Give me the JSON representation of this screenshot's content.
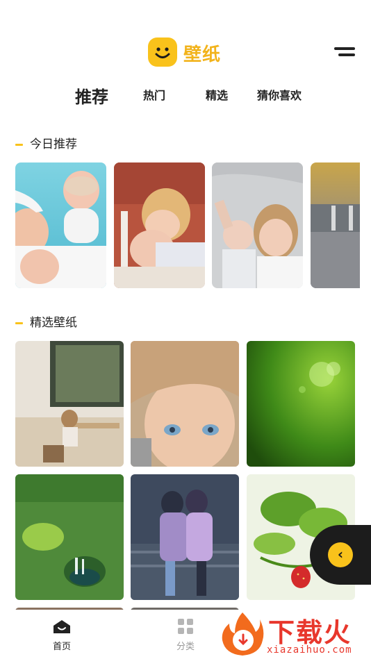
{
  "header": {
    "app_title": "壁纸",
    "logo_icon": "smiley-face-icon",
    "menu_icon": "menu-icon"
  },
  "tabs": [
    {
      "label": "推荐",
      "active": true
    },
    {
      "label": "热门",
      "active": false
    },
    {
      "label": "精选",
      "active": false
    },
    {
      "label": "猜你喜欢",
      "active": false
    }
  ],
  "sections": {
    "today": {
      "title": "今日推荐"
    },
    "featured": {
      "title": "精选壁纸"
    }
  },
  "today_images": [
    {
      "name": "mother-baby-beach"
    },
    {
      "name": "child-kissing-baby"
    },
    {
      "name": "children-lying-blanket"
    },
    {
      "name": "pier-sunset"
    }
  ],
  "featured_images": [
    {
      "name": "child-at-window"
    },
    {
      "name": "girl-blue-eyes"
    },
    {
      "name": "green-water-drops"
    },
    {
      "name": "forest-waterfall"
    },
    {
      "name": "couple-hugging-illustration"
    },
    {
      "name": "strawberry-plant"
    }
  ],
  "float_button": {
    "icon": "chevron-left-icon",
    "glyph": "‹"
  },
  "bottom_nav": [
    {
      "label": "首页",
      "icon": "home-icon",
      "active": true
    },
    {
      "label": "分类",
      "icon": "grid-icon",
      "active": false
    }
  ],
  "watermark": {
    "text": "下载火",
    "sub": "xiazaihuo.com"
  },
  "colors": {
    "accent": "#f9c21b",
    "active_text": "#222222",
    "inactive_text": "#999999",
    "watermark": "#e8372c"
  }
}
